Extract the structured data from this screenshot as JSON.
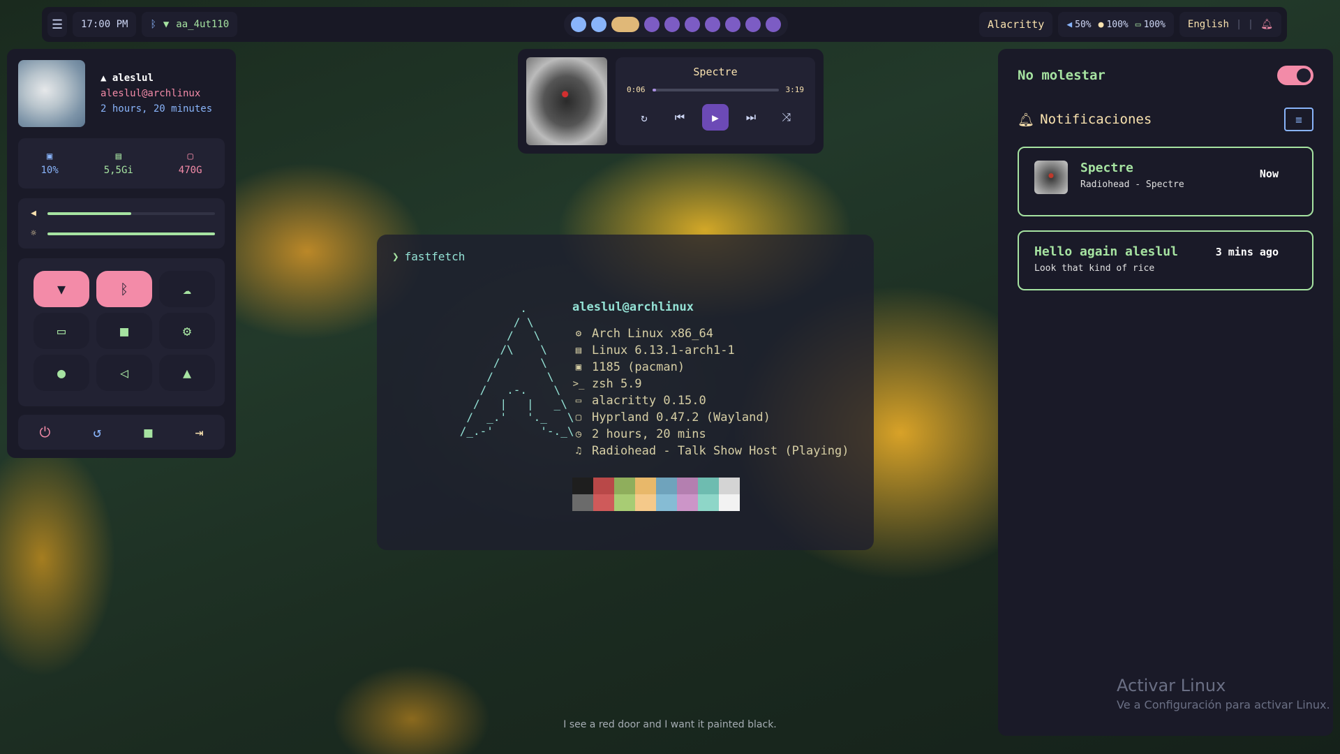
{
  "topbar": {
    "menu_icon": "menu-collapse-icon",
    "clock": "17:00 PM",
    "bluetooth_icon": "bluetooth-icon",
    "wifi_icon": "wifi-icon",
    "network_name": "aa_4ut110",
    "workspaces": [
      {
        "state": "active"
      },
      {
        "state": "active"
      },
      {
        "state": "focused"
      },
      {
        "state": "occupied"
      },
      {
        "state": "occupied"
      },
      {
        "state": "occupied"
      },
      {
        "state": "occupied"
      },
      {
        "state": "occupied"
      },
      {
        "state": "occupied"
      },
      {
        "state": "occupied"
      }
    ],
    "active_app": "Alacritty",
    "volume": "50%",
    "brightness": "100%",
    "battery": "100%",
    "language": "English",
    "separator": "| |"
  },
  "profile": {
    "username": "aleslul",
    "host": "aleslul@archlinux",
    "uptime": "2 hours, 20 minutes"
  },
  "stats": {
    "cpu": "10%",
    "ram": "5,5Gi",
    "disk": "470G"
  },
  "sliders": {
    "volume_level": 0.5,
    "brightness_level": 1.0
  },
  "quick_toggles": [
    {
      "name": "wifi-toggle",
      "icon": "wifi-icon",
      "state": "on"
    },
    {
      "name": "bluetooth-toggle",
      "icon": "bluetooth-icon",
      "state": "on"
    },
    {
      "name": "weather-toggle",
      "icon": "cloud-sun-icon",
      "state": "off"
    },
    {
      "name": "screen-toggle",
      "icon": "monitor-icon",
      "state": "off"
    },
    {
      "name": "files-toggle",
      "icon": "folder-icon",
      "state": "off"
    },
    {
      "name": "settings-toggle",
      "icon": "gear-icon",
      "state": "off"
    },
    {
      "name": "steam-toggle",
      "icon": "steam-icon",
      "state": "off"
    },
    {
      "name": "vscode-toggle",
      "icon": "vscode-icon",
      "state": "off"
    },
    {
      "name": "arch-toggle",
      "icon": "arch-icon",
      "state": "off"
    }
  ],
  "power_buttons": [
    "power-icon",
    "restart-icon",
    "lock-icon",
    "logout-icon"
  ],
  "player": {
    "title": "Spectre",
    "elapsed": "0:06",
    "duration": "3:19",
    "progress": 0.03
  },
  "terminal": {
    "prompt_symbol": "❯",
    "command": "fastfetch",
    "host": "aleslul@archlinux",
    "lines": [
      {
        "icon": "gear-icon",
        "text": "Arch Linux x86_64"
      },
      {
        "icon": "server-icon",
        "text": "Linux 6.13.1-arch1-1"
      },
      {
        "icon": "package-icon",
        "text": "1185 (pacman)"
      },
      {
        "icon": "shell-icon",
        "text": "zsh 5.9"
      },
      {
        "icon": "terminal-icon",
        "text": "alacritty 0.15.0"
      },
      {
        "icon": "window-icon",
        "text": "Hyprland 0.47.2 (Wayland)"
      },
      {
        "icon": "clock-icon",
        "text": "2 hours, 20 mins"
      },
      {
        "icon": "music-icon",
        "text": "Radiohead - Talk Show Host (Playing)"
      }
    ],
    "palette_top": [
      "#1e1e1e",
      "#b94848",
      "#8fae5c",
      "#e8b86a",
      "#6fa3bc",
      "#b47fb0",
      "#6ebcb0",
      "#d4d4d4"
    ],
    "palette_bottom": [
      "#6b6b6b",
      "#cf5a5a",
      "#a8cc74",
      "#f5c98a",
      "#86bcd4",
      "#cc95c8",
      "#8ed6c8",
      "#f2f2f2"
    ]
  },
  "notifications": {
    "dnd_label": "No molestar",
    "dnd_on": true,
    "header": "Notificaciones",
    "items": [
      {
        "title": "Spectre",
        "body": "Radiohead - Spectre",
        "time": "Now",
        "has_thumb": true
      },
      {
        "title": "Hello again aleslul",
        "body": "Look that kind of rice",
        "time": "3 mins ago",
        "has_thumb": false
      }
    ]
  },
  "lyric": "I see a red door and I want it painted black.",
  "watermark": {
    "title": "Activar Linux",
    "subtitle": "Ve a Configuración para activar Linux."
  },
  "colors": {
    "accent_green": "#a6e3a1",
    "accent_pink": "#f38ba8",
    "accent_blue": "#89b4fa",
    "accent_yellow": "#f9e2af",
    "accent_purple": "#6c4ab6"
  }
}
